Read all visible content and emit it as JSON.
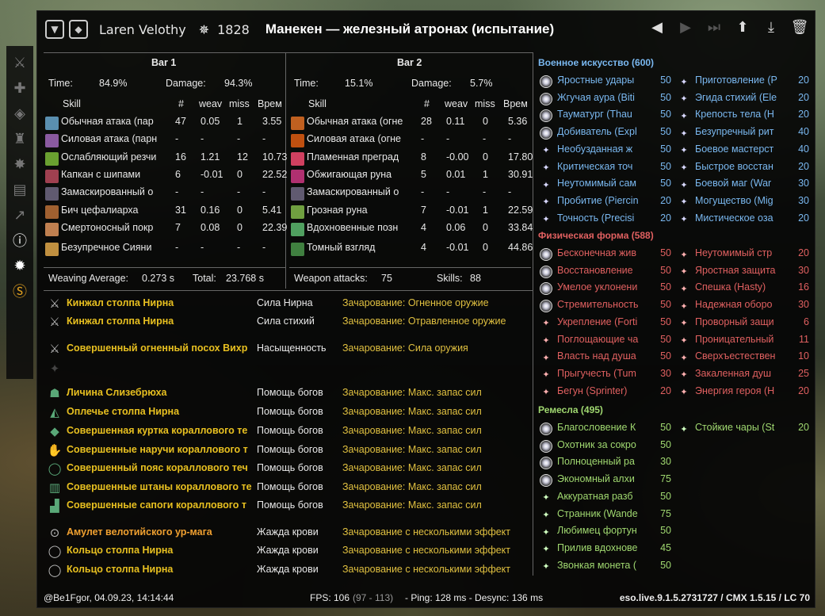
{
  "header": {
    "player": "Laren Velothy",
    "cp": "1828",
    "title": "Манекен — железный атронах (испытание)"
  },
  "bar1": {
    "title": "Bar 1",
    "time_label": "Time:",
    "time": "84.9%",
    "damage_label": "Damage:",
    "damage": "94.3%",
    "cols": [
      "Skill",
      "#",
      "weav",
      "miss",
      "Врем"
    ],
    "rows": [
      [
        "Обычная атака (пар",
        "47",
        "0.05",
        "1",
        "3.55"
      ],
      [
        "Силовая атака (парн",
        "-",
        "-",
        "-",
        "-"
      ],
      [
        "Ослабляющий резчи",
        "16",
        "1.21",
        "12",
        "10.73"
      ],
      [
        "Капкан с шипами",
        "6",
        "-0.01",
        "0",
        "22.52"
      ],
      [
        "Замаскированный о",
        "-",
        "-",
        "-",
        "-"
      ],
      [
        "Бич цефалиарха",
        "31",
        "0.16",
        "0",
        "5.41"
      ],
      [
        "Смертоносный покр",
        "7",
        "0.08",
        "0",
        "22.39"
      ],
      [
        "Безупречное Сияни",
        "-",
        "-",
        "-",
        "-"
      ]
    ],
    "weaving_label": "Weaving Average:",
    "weaving": "0.273 s",
    "total_label": "Total:",
    "total": "23.768 s"
  },
  "bar2": {
    "title": "Bar 2",
    "time_label": "Time:",
    "time": "15.1%",
    "damage_label": "Damage:",
    "damage": "5.7%",
    "cols": [
      "Skill",
      "#",
      "weav",
      "miss",
      "Врем"
    ],
    "rows": [
      [
        "Обычная атака (огне",
        "28",
        "0.11",
        "0",
        "5.36"
      ],
      [
        "Силовая атака (огне",
        "-",
        "-",
        "-",
        "-"
      ],
      [
        "Пламенная преград",
        "8",
        "-0.00",
        "0",
        "17.80"
      ],
      [
        "Обжигающая руна",
        "5",
        "0.01",
        "1",
        "30.91"
      ],
      [
        "Замаскированный о",
        "-",
        "-",
        "-",
        "-"
      ],
      [
        "Грозная руна",
        "7",
        "-0.01",
        "1",
        "22.59"
      ],
      [
        "Вдохновенные позн",
        "4",
        "0.06",
        "0",
        "33.84"
      ],
      [
        "Томный взгляд",
        "4",
        "-0.01",
        "0",
        "44.86"
      ]
    ],
    "weapon_label": "Weapon attacks:",
    "weapon": "75",
    "skills_label": "Skills:",
    "skills": "88"
  },
  "gear": [
    {
      "name": "Кинжал столпа Нирна",
      "set": "Сила Нирна",
      "ench": "Зачарование: Огненное оружие",
      "color": "yellow",
      "icon": "dagger-icon"
    },
    {
      "name": "Кинжал столпа Нирна",
      "set": "Сила стихий",
      "ench": "Зачарование: Отравленное оружие",
      "color": "yellow",
      "icon": "dagger-icon"
    },
    {
      "name": "Совершенный огненный посох Вихр",
      "set": "Насыщенность",
      "ench": "Зачарование: Сила оружия",
      "color": "yellow",
      "icon": "staff-icon"
    },
    {
      "name": "Личина Слизебрюха",
      "set": "Помощь богов",
      "ench": "Зачарование: Макс. запас сил",
      "color": "yellow",
      "icon": "helmet-icon"
    },
    {
      "name": "Оплечье столпа Нирна",
      "set": "Помощь богов",
      "ench": "Зачарование: Макс. запас сил",
      "color": "yellow",
      "icon": "shoulder-icon"
    },
    {
      "name": "Совершенная куртка кораллового те",
      "set": "Помощь богов",
      "ench": "Зачарование: Макс. запас сил",
      "color": "yellow",
      "icon": "chest-icon"
    },
    {
      "name": "Совершенные наручи кораллового т",
      "set": "Помощь богов",
      "ench": "Зачарование: Макс. запас сил",
      "color": "yellow",
      "icon": "gloves-icon"
    },
    {
      "name": "Совершенный пояс кораллового теч",
      "set": "Помощь богов",
      "ench": "Зачарование: Макс. запас сил",
      "color": "yellow",
      "icon": "belt-icon"
    },
    {
      "name": "Совершенные штаны кораллового те",
      "set": "Помощь богов",
      "ench": "Зачарование: Макс. запас сил",
      "color": "yellow",
      "icon": "legs-icon"
    },
    {
      "name": "Совершенные сапоги кораллового т",
      "set": "Помощь богов",
      "ench": "Зачарование: Макс. запас сил",
      "color": "yellow",
      "icon": "boots-icon"
    },
    {
      "name": "Амулет велотийского ур-мага",
      "set": "Жажда крови",
      "ench": "Зачарование с несколькими эффект",
      "color": "orange",
      "icon": "amulet-icon"
    },
    {
      "name": "Кольцо столпа Нирна",
      "set": "Жажда крови",
      "ench": "Зачарование с несколькими эффект",
      "color": "yellow",
      "icon": "ring-icon"
    },
    {
      "name": "Кольцо столпа Нирна",
      "set": "Жажда крови",
      "ench": "Зачарование с несколькими эффект",
      "color": "yellow",
      "icon": "ring-icon"
    }
  ],
  "cp": {
    "warfare": {
      "title": "Военное искусство (600)",
      "left": [
        [
          "Яростные удары",
          "50",
          true
        ],
        [
          "Жгучая аура (Biti",
          "50",
          true
        ],
        [
          "Тауматург (Thau",
          "50",
          true
        ],
        [
          "Добиватель (Expl",
          "50",
          true
        ],
        [
          "Необузданная ж",
          "50",
          false
        ],
        [
          "Критическая точ",
          "50",
          false
        ],
        [
          "Неутомимый сам",
          "50",
          false
        ],
        [
          "Пробитие (Piercin",
          "20",
          false
        ],
        [
          "Точность (Precisi",
          "20",
          false
        ]
      ],
      "right": [
        [
          "Приготовление (P",
          "20"
        ],
        [
          "Эгида стихий (Ele",
          "20"
        ],
        [
          "Крепость тела (H",
          "20"
        ],
        [
          "Безупречный рит",
          "40"
        ],
        [
          "Боевое мастерст",
          "40"
        ],
        [
          "Быстрое восстан",
          "20"
        ],
        [
          "Боевой маг (War",
          "30"
        ],
        [
          "Могущество (Mig",
          "30"
        ],
        [
          "Мистическое оза",
          "20"
        ]
      ]
    },
    "fitness": {
      "title": "Физическая форма (588)",
      "left": [
        [
          "Бесконечная жив",
          "50",
          true
        ],
        [
          "Восстановление",
          "50",
          true
        ],
        [
          "Умелое уклонени",
          "50",
          true
        ],
        [
          "Стремительность",
          "50",
          true
        ],
        [
          "Укрепление (Forti",
          "50",
          false
        ],
        [
          "Поглощающие ча",
          "50",
          false
        ],
        [
          "Власть над душа",
          "50",
          false
        ],
        [
          "Прыгучесть (Tum",
          "30",
          false
        ],
        [
          "Бегун (Sprinter)",
          "20",
          false
        ]
      ],
      "right": [
        [
          "Неутомимый стр",
          "20"
        ],
        [
          "Яростная защита",
          "30"
        ],
        [
          "Спешка (Hasty)",
          "16"
        ],
        [
          "Надежная оборо",
          "30"
        ],
        [
          "Проворный защи",
          "6"
        ],
        [
          "Проницательный",
          "11"
        ],
        [
          "Сверхъестествен",
          "10"
        ],
        [
          "Закаленная душ",
          "25"
        ],
        [
          "Энергия героя (Н",
          "20"
        ]
      ]
    },
    "craft": {
      "title": "Ремесла (495)",
      "left": [
        [
          "Благословение К",
          "50",
          true
        ],
        [
          "Охотник за сокро",
          "50",
          true
        ],
        [
          "Полноценный ра",
          "30",
          true
        ],
        [
          "Экономный алхи",
          "75",
          true
        ],
        [
          "Аккуратная разб",
          "50",
          false
        ],
        [
          "Странник (Wande",
          "75",
          false
        ],
        [
          "Любимец фортун",
          "50",
          false
        ],
        [
          "Прилив вдохнове",
          "45",
          false
        ],
        [
          "Звонкая монета (",
          "50",
          false
        ]
      ],
      "right": [
        [
          "Стойкие чары (St",
          "20"
        ]
      ]
    }
  },
  "footer": {
    "user": "@Be1Fgor, 04.09.23, 14:14:44",
    "fps_label": "FPS: 106",
    "fps_range": "(97 - 113)",
    "ping": "- Ping: 128 ms - Desync: 136 ms",
    "version": "eso.live.9.1.5.2731727 / CMX 1.5.15 / LC 70"
  }
}
